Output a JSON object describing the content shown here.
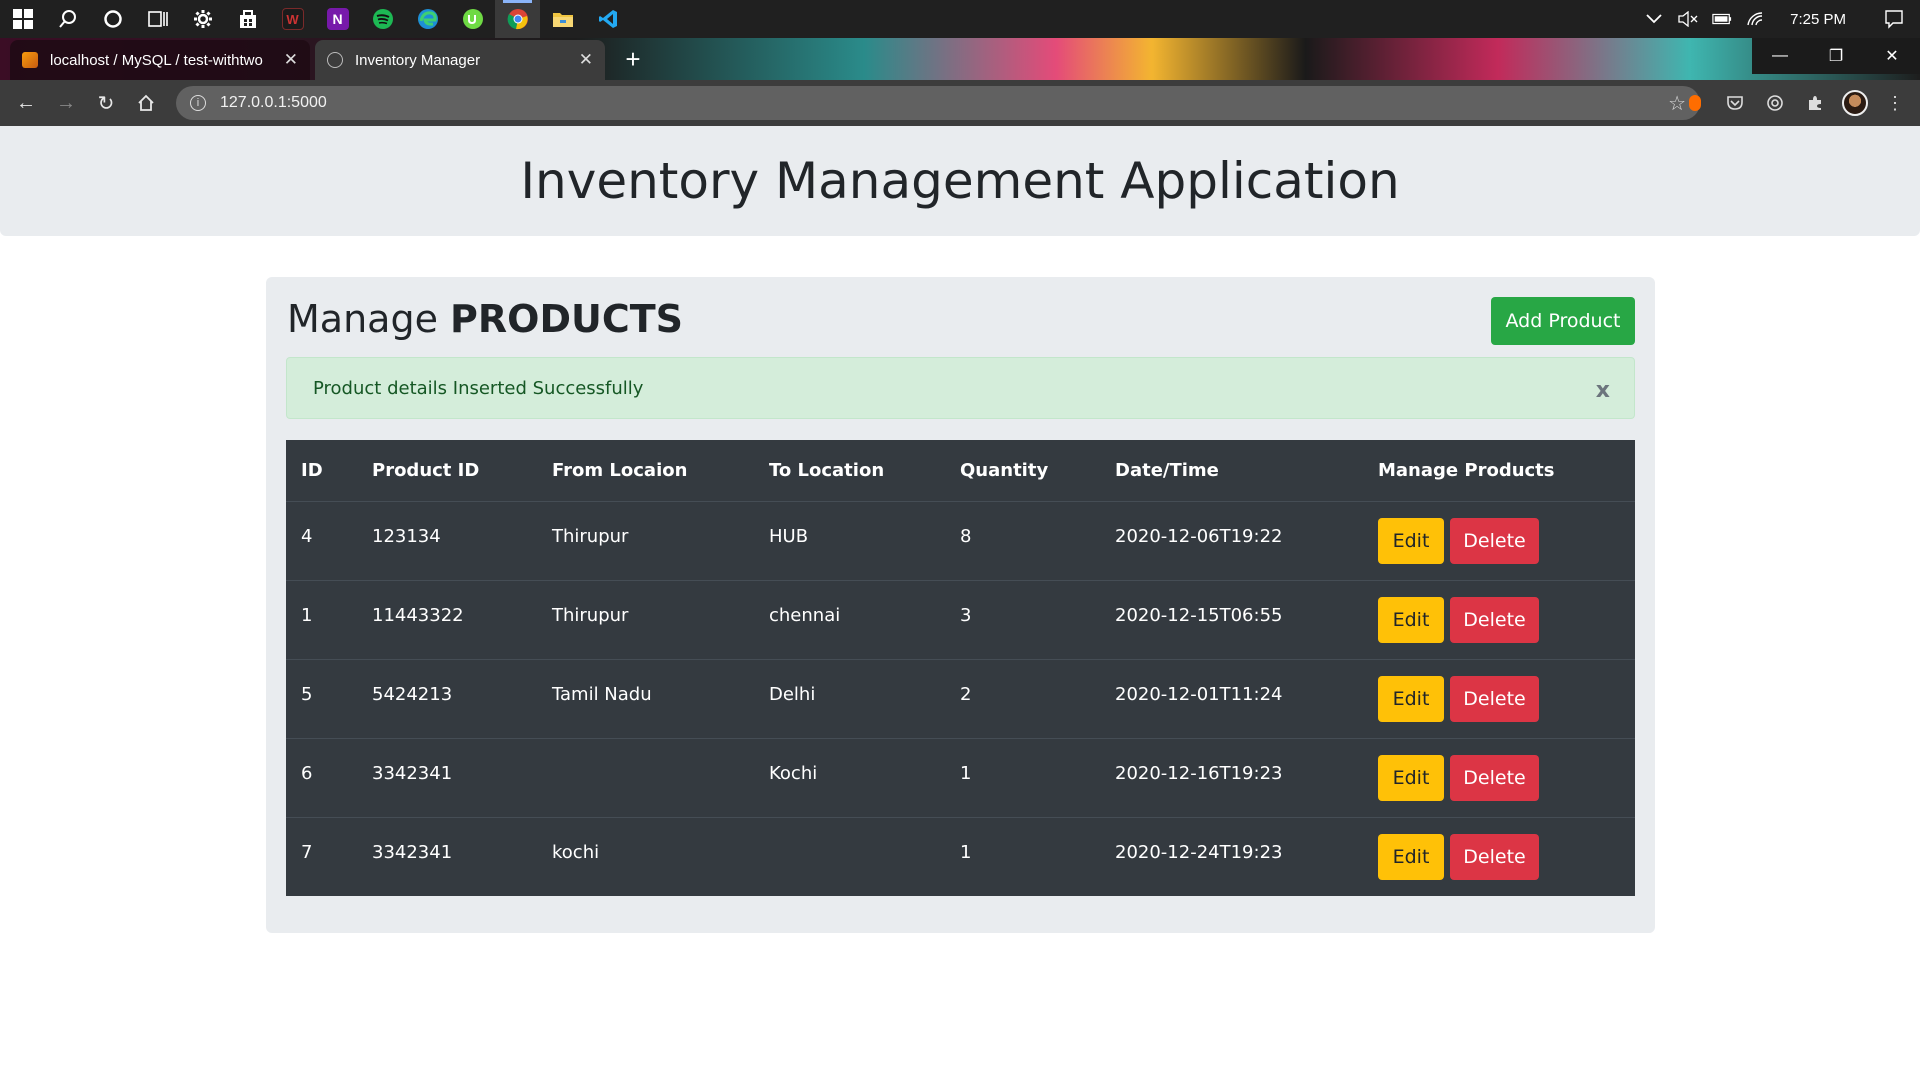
{
  "taskbar": {
    "icons": [
      "windows-start-icon",
      "search-icon",
      "cortana-icon",
      "task-view-icon",
      "settings-icon",
      "store-icon",
      "game-icon",
      "onenote-icon",
      "spotify-icon",
      "edge-icon",
      "upwork-icon",
      "chrome-icon",
      "file-explorer-icon",
      "vscode-icon"
    ],
    "time": "7:25 PM"
  },
  "browser": {
    "tabs": [
      {
        "title": "localhost / MySQL / test-withtwo",
        "active": false
      },
      {
        "title": "Inventory Manager",
        "active": true
      }
    ],
    "url": "127.0.0.1:5000"
  },
  "page": {
    "heading": "Inventory Management Application",
    "section_title_prefix": "Manage",
    "section_title_bold": "PRODUCTS",
    "add_button": "Add Product",
    "alert_message": "Product details Inserted Successfully",
    "alert_close": "x",
    "table": {
      "headers": [
        "ID",
        "Product ID",
        "From Locaion",
        "To Location",
        "Quantity",
        "Date/Time",
        "Manage Products"
      ],
      "rows": [
        {
          "id": "4",
          "product_id": "123134",
          "from": "Thirupur",
          "to": "HUB",
          "qty": "8",
          "datetime": "2020-12-06T19:22"
        },
        {
          "id": "1",
          "product_id": "11443322",
          "from": "Thirupur",
          "to": "chennai",
          "qty": "3",
          "datetime": "2020-12-15T06:55"
        },
        {
          "id": "5",
          "product_id": "5424213",
          "from": "Tamil Nadu",
          "to": "Delhi",
          "qty": "2",
          "datetime": "2020-12-01T11:24"
        },
        {
          "id": "6",
          "product_id": "3342341",
          "from": "",
          "to": "Kochi",
          "qty": "1",
          "datetime": "2020-12-16T19:23"
        },
        {
          "id": "7",
          "product_id": "3342341",
          "from": "kochi",
          "to": "",
          "qty": "1",
          "datetime": "2020-12-24T19:23"
        }
      ],
      "edit_label": "Edit",
      "delete_label": "Delete"
    }
  },
  "colors": {
    "success": "#28a745",
    "warning": "#ffc107",
    "danger": "#dc3545",
    "table_dark": "#343a40",
    "jumbotron": "#e9ecef",
    "alert_bg": "#d4edda"
  }
}
